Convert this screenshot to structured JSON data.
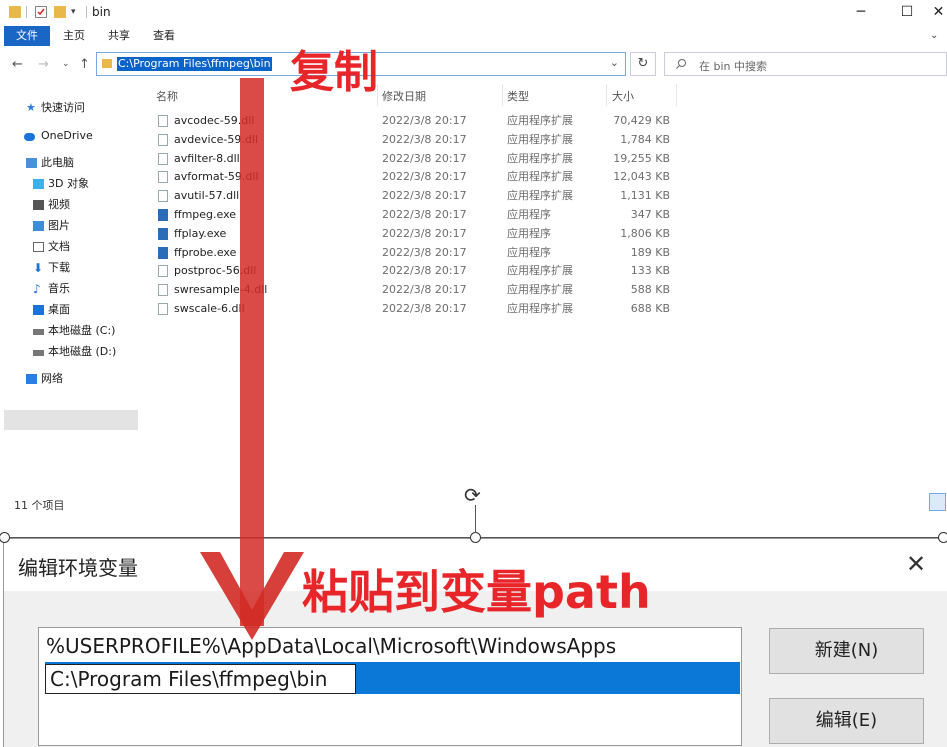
{
  "window": {
    "title": "bin",
    "controls": {
      "minimize": "─",
      "maximize": "☐",
      "close": "✕"
    }
  },
  "ribbon": {
    "tabs": [
      "文件",
      "主页",
      "共享",
      "查看"
    ]
  },
  "address": {
    "path": "C:\\Program Files\\ffmpeg\\bin",
    "search_placeholder": "在 bin 中搜索"
  },
  "nav": {
    "items": [
      {
        "label": "快速访问",
        "icon": "star-icon",
        "color": "#2a7de1"
      },
      {
        "label": "OneDrive",
        "icon": "cloud-icon",
        "color": "#1a73d9"
      },
      {
        "label": "此电脑",
        "icon": "pc-icon",
        "color": "#4a90d9"
      },
      {
        "label": "3D 对象",
        "icon": "cube-icon",
        "color": "#3ab0e8"
      },
      {
        "label": "视频",
        "icon": "video-icon",
        "color": "#555"
      },
      {
        "label": "图片",
        "icon": "picture-icon",
        "color": "#3a8fd8"
      },
      {
        "label": "文档",
        "icon": "document-icon",
        "color": "#666"
      },
      {
        "label": "下载",
        "icon": "download-icon",
        "color": "#1a73d9"
      },
      {
        "label": "音乐",
        "icon": "music-icon",
        "color": "#1a73d9"
      },
      {
        "label": "桌面",
        "icon": "desktop-icon",
        "color": "#1a73d9"
      },
      {
        "label": "本地磁盘 (C:)",
        "icon": "drive-icon",
        "color": "#777"
      },
      {
        "label": "本地磁盘 (D:)",
        "icon": "drive-icon",
        "color": "#777"
      },
      {
        "label": "网络",
        "icon": "network-icon",
        "color": "#2a7de1"
      }
    ]
  },
  "files": {
    "headers": [
      "名称",
      "修改日期",
      "类型",
      "大小"
    ],
    "rows": [
      {
        "name": "avcodec-59.dll",
        "date": "2022/3/8 20:17",
        "type": "应用程序扩展",
        "size": "70,429 KB",
        "kind": "dll"
      },
      {
        "name": "avdevice-59.dll",
        "date": "2022/3/8 20:17",
        "type": "应用程序扩展",
        "size": "1,784 KB",
        "kind": "dll"
      },
      {
        "name": "avfilter-8.dll",
        "date": "2022/3/8 20:17",
        "type": "应用程序扩展",
        "size": "19,255 KB",
        "kind": "dll"
      },
      {
        "name": "avformat-59.dll",
        "date": "2022/3/8 20:17",
        "type": "应用程序扩展",
        "size": "12,043 KB",
        "kind": "dll"
      },
      {
        "name": "avutil-57.dll",
        "date": "2022/3/8 20:17",
        "type": "应用程序扩展",
        "size": "1,131 KB",
        "kind": "dll"
      },
      {
        "name": "ffmpeg.exe",
        "date": "2022/3/8 20:17",
        "type": "应用程序",
        "size": "347 KB",
        "kind": "exe"
      },
      {
        "name": "ffplay.exe",
        "date": "2022/3/8 20:17",
        "type": "应用程序",
        "size": "1,806 KB",
        "kind": "exe"
      },
      {
        "name": "ffprobe.exe",
        "date": "2022/3/8 20:17",
        "type": "应用程序",
        "size": "189 KB",
        "kind": "exe"
      },
      {
        "name": "postproc-56.dll",
        "date": "2022/3/8 20:17",
        "type": "应用程序扩展",
        "size": "133 KB",
        "kind": "dll"
      },
      {
        "name": "swresample-4.dll",
        "date": "2022/3/8 20:17",
        "type": "应用程序扩展",
        "size": "588 KB",
        "kind": "dll"
      },
      {
        "name": "swscale-6.dll",
        "date": "2022/3/8 20:17",
        "type": "应用程序扩展",
        "size": "688 KB",
        "kind": "dll"
      }
    ]
  },
  "status": {
    "count": "11 个项目"
  },
  "dialog": {
    "title": "编辑环境变量",
    "entries": [
      "%USERPROFILE%\\AppData\\Local\\Microsoft\\WindowsApps",
      "C:\\Program Files\\ffmpeg\\bin"
    ],
    "buttons": {
      "new": "新建(N)",
      "edit": "编辑(E)"
    }
  },
  "annotations": {
    "copy": "复制",
    "paste": "粘贴到变量path",
    "color": "#e8262a"
  }
}
